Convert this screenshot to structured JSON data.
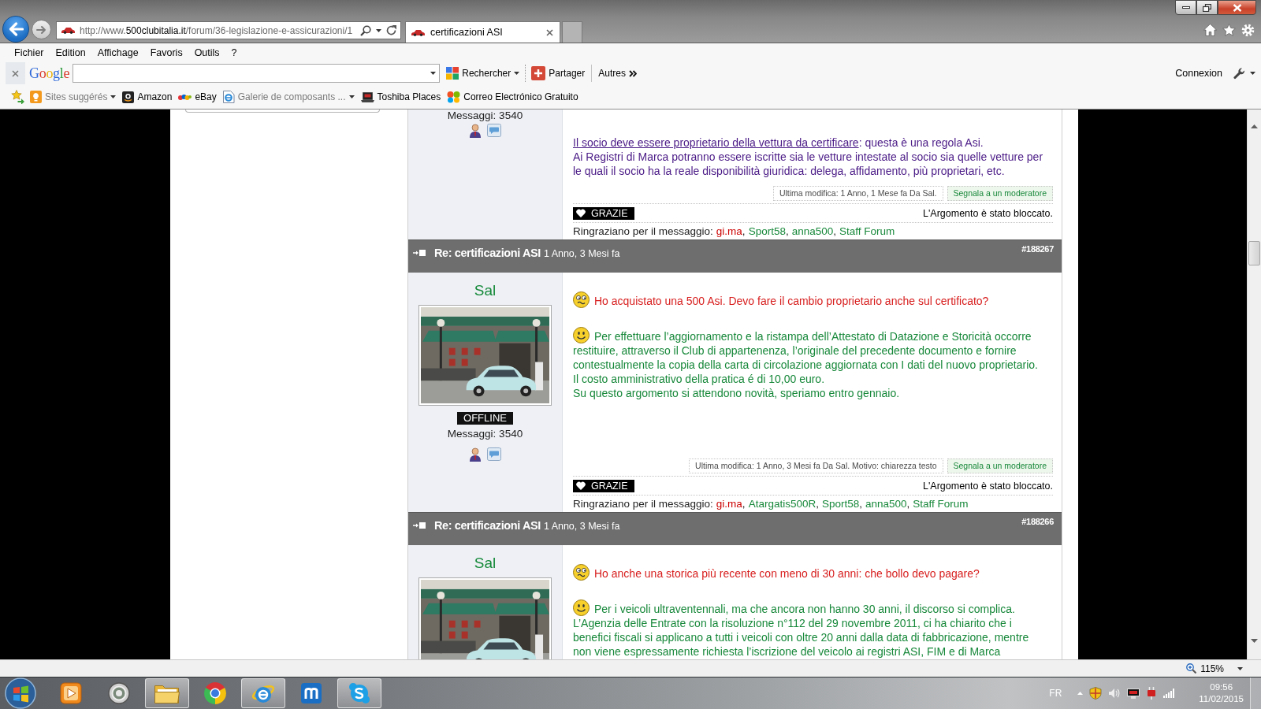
{
  "browser": {
    "address": {
      "scheme": "http://www.",
      "domain": "500clubitalia.it",
      "path": "/forum/36-legislazione-e-assicurazioni/1"
    },
    "tabs": [
      {
        "title": "certificazioni ASI",
        "selected": true
      }
    ],
    "menu": [
      "Fichier",
      "Edition",
      "Affichage",
      "Favoris",
      "Outils",
      "?"
    ],
    "toolbar": {
      "logo": "Google",
      "buttons": [
        {
          "kind": "search",
          "label": "Rechercher"
        },
        {
          "kind": "share",
          "label": "Partager"
        },
        {
          "kind": "more",
          "label": "Autres"
        }
      ],
      "sign_in": "Connexion"
    },
    "favorites": [
      {
        "kind": "suggested",
        "label": "Sites suggérés",
        "disabled": true
      },
      {
        "kind": "amazon",
        "label": "Amazon",
        "disabled": false
      },
      {
        "kind": "ebay",
        "label": "eBay",
        "disabled": false
      },
      {
        "kind": "gallery",
        "label": "Galerie de composants ...",
        "disabled": true
      },
      {
        "kind": "toshiba",
        "label": "Toshiba Places",
        "disabled": false
      },
      {
        "kind": "mail",
        "label": "Correo Electrónico Gratuito",
        "disabled": false
      }
    ]
  },
  "page": {
    "posts": [
      {
        "author": {
          "messages": "Messaggi: 3540"
        },
        "paragraphs": [
          {
            "kind": "note",
            "link": "Il socio deve essere proprietario della vettura da certificare",
            "text": ": questa è una regola Asi.\nAi Registri di Marca potranno essere iscritte sia le vetture intestate al socio sia quelle vetture per le quali il socio ha la reale disponibilità giuridica: delega, affidamento, più proprietari, etc."
          }
        ],
        "edit_note": "Ultima modifica: 1 Anno, 1 Mese fa Da Sal.",
        "report_link": "Segnala a un moderatore",
        "thanks_button": "GRAZIE",
        "locked_note": "L'Argomento è stato bloccato.",
        "thanks": {
          "label": "Ringraziano per il messaggio:",
          "separator": ",",
          "users": [
            {
              "name": "gi.ma",
              "color": "#cc0000"
            },
            {
              "name": "Sport58",
              "color": "#17883a"
            },
            {
              "name": "anna500",
              "color": "#17883a"
            },
            {
              "name": "Staff Forum",
              "color": "#17883a"
            }
          ]
        }
      },
      {
        "header": {
          "title": "Re: certificazioni ASI",
          "time": "1 Anno, 3 Mesi fa",
          "number": "#188267"
        },
        "author": {
          "name": "Sal",
          "avatar": {
            "kind": "photo"
          },
          "status": "OFFLINE",
          "messages": "Messaggi: 3540"
        },
        "paragraphs": [
          {
            "kind": "question",
            "text": "Ho acquistato una 500 Asi. Devo fare il cambio proprietario anche sul certificato?"
          },
          {
            "kind": "answer",
            "text": "Per effettuare l’aggiornamento e la ristampa dell’Attestato di Datazione e Storicità occorre restituire, attraverso il Club di appartenenza, l’originale del precedente documento e fornire contestualmente la copia della carta di circolazione aggiornata con I dati del nuovo proprietario.\nIl costo amministrativo della pratica é di 10,00 euro.\nSu questo argomento si attendono novità, speriamo entro gennaio."
          }
        ],
        "edit_note": "Ultima modifica: 1 Anno, 3 Mesi fa Da Sal. Motivo: chiarezza testo",
        "report_link": "Segnala a un moderatore",
        "thanks_button": "GRAZIE",
        "locked_note": "L'Argomento è stato bloccato.",
        "thanks": {
          "label": "Ringraziano per il messaggio:",
          "separator": ",",
          "users": [
            {
              "name": "gi.ma",
              "color": "#cc0000"
            },
            {
              "name": "Atargatis500R",
              "color": "#17883a"
            },
            {
              "name": "Sport58",
              "color": "#17883a"
            },
            {
              "name": "anna500",
              "color": "#17883a"
            },
            {
              "name": "Staff Forum",
              "color": "#17883a"
            }
          ]
        }
      },
      {
        "header": {
          "title": "Re: certificazioni ASI",
          "time": "1 Anno, 3 Mesi fa",
          "number": "#188266"
        },
        "author": {
          "name": "Sal",
          "avatar": {
            "kind": "photo"
          }
        },
        "paragraphs": [
          {
            "kind": "question",
            "text": "Ho anche una storica più recente con meno di 30 anni: che bollo devo pagare?"
          },
          {
            "kind": "answer",
            "text": "Per i veicoli ultraventennali, ma che ancora non hanno 30 anni, il discorso si complica.\nL’Agenzia delle Entrate con la risoluzione n°112 del 29 novembre 2011, ci ha chiarito che i benefici fiscali si applicano a tutti i veicoli con oltre 20 anni dalla data di fabbricazione, mentre non viene espressamente richiesta l’iscrizione del veicolo ai registri ASI, FIM e di Marca"
          }
        ]
      }
    ]
  },
  "status_bar": {
    "zoom": "115%"
  },
  "taskbar": {
    "apps": [
      {
        "kind": "media",
        "running": false
      },
      {
        "kind": "ring",
        "running": false
      },
      {
        "kind": "folder",
        "running": true
      },
      {
        "kind": "wheel",
        "running": false
      },
      {
        "kind": "globe",
        "running": true
      },
      {
        "kind": "arch",
        "running": false
      },
      {
        "kind": "cloud",
        "running": true
      }
    ],
    "language": "FR",
    "time": "09:56",
    "date": "11/02/2015"
  }
}
